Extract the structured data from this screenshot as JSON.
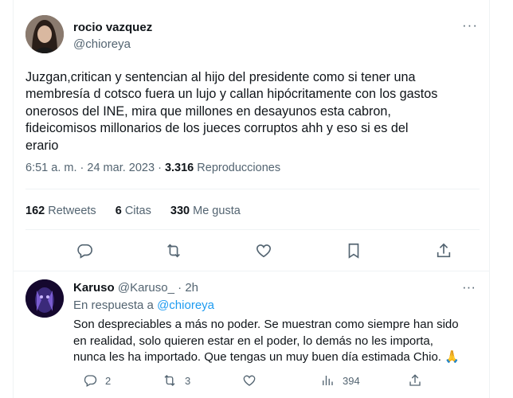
{
  "tweet": {
    "author_name": "rocio vazquez",
    "author_handle": "@chioreya",
    "more_label": "···",
    "text": "Juzgan,critican y sentencian al hijo del presidente como si tener una\nmembresía d cotsco fuera un lujo y callan hipócritamente con los gastos\nonerosos del INE, mira que millones en desayunos esta cabron,\nfideicomisos millonarios de los jueces corruptos ahh y eso si es del\nerario",
    "time": "6:51 a. m.",
    "separator": "·",
    "date": "24 mar. 2023",
    "views_count": "3.316",
    "views_label": "Reproducciones",
    "stats": {
      "retweets_count": "162",
      "retweets_label": "Retweets",
      "quotes_count": "6",
      "quotes_label": "Citas",
      "likes_count": "330",
      "likes_label": "Me gusta"
    },
    "actions": [
      "reply-icon",
      "retweet-icon",
      "like-icon",
      "bookmark-icon",
      "share-icon"
    ]
  },
  "reply": {
    "author_name": "Karuso",
    "author_handle": "@Karuso_",
    "separator": "·",
    "time": "2h",
    "more_label": "···",
    "in_reply_prefix": "En respuesta a",
    "in_reply_handle": "@chioreya",
    "text": "Son despreciables a más no poder. Se muestran como siempre han sido\nen realidad, solo quieren estar en el poder, lo demás no les importa,\nnunca les ha importado. Que tengas un muy buen día estimada Chio. 🙏",
    "replies_count": "2",
    "retweets_count": "3",
    "likes_count": "",
    "views_count": "394"
  },
  "colors": {
    "text": "#0f1419",
    "secondary": "#536471",
    "link": "#1d9bf0",
    "border": "#eff3f4"
  }
}
